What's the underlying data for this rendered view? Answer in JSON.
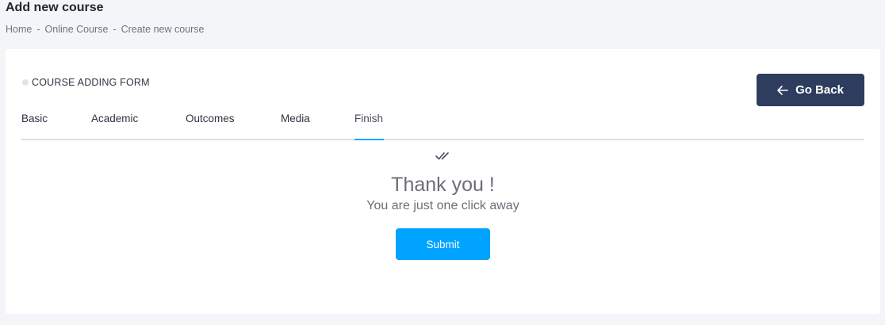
{
  "header": {
    "title": "Add new course",
    "breadcrumb": [
      "Home",
      "Online Course",
      "Create new course"
    ],
    "separator": "-"
  },
  "form": {
    "title": "COURSE ADDING FORM",
    "go_back_label": "Go Back",
    "go_back_icon": "arrow-left-icon",
    "tabs": [
      {
        "label": "Basic",
        "active": false
      },
      {
        "label": "Academic",
        "active": false
      },
      {
        "label": "Outcomes",
        "active": false
      },
      {
        "label": "Media",
        "active": false
      },
      {
        "label": "Finish",
        "active": true
      }
    ]
  },
  "finish": {
    "icon": "double-check-icon",
    "heading": "Thank you !",
    "message": "You are just one click away",
    "submit_label": "Submit"
  },
  "colors": {
    "page_bg": "#f4f5f8",
    "go_back_bg": "#2e3d5e",
    "submit_bg": "#00a3ff",
    "active_tab_underline": "#1aa7ff"
  }
}
